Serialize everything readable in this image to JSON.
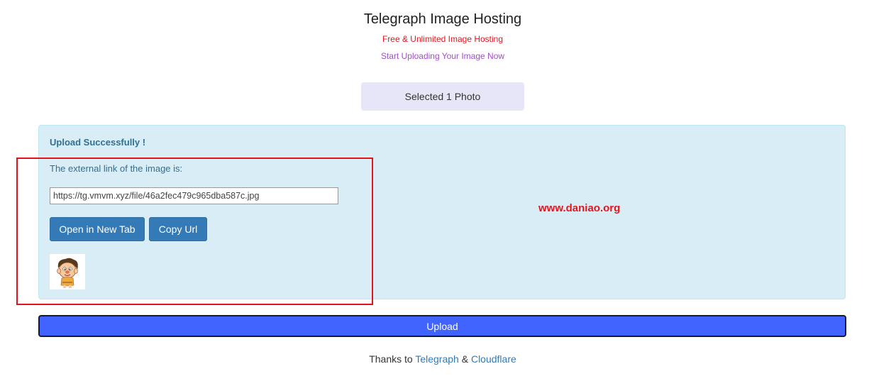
{
  "header": {
    "title": "Telegraph Image Hosting",
    "subtitle_red": "Free & Unlimited Image Hosting",
    "subtitle_purple": "Start Uploading Your Image Now"
  },
  "selection": {
    "label": "Selected 1 Photo"
  },
  "result": {
    "title": "Upload Successfully !",
    "link_label": "The external link of the image is:",
    "url": "https://tg.vmvm.xyz/file/46a2fec479c965dba587c.jpg",
    "open_button": "Open in New Tab",
    "copy_button": "Copy Url",
    "thumbnail_icon": "cartoon-character-thumbnail"
  },
  "watermark": "www.daniao.org",
  "upload_button": "Upload",
  "footer": {
    "prefix": "Thanks to",
    "link1": "Telegraph",
    "separator": "&",
    "link2": "Cloudflare"
  },
  "colors": {
    "alert_bg": "#d9edf7",
    "alert_text": "#31708f",
    "button_primary": "#337ab7",
    "upload_button": "#4163ff",
    "accent_red": "#e8141c",
    "accent_purple": "#a04fc8"
  }
}
